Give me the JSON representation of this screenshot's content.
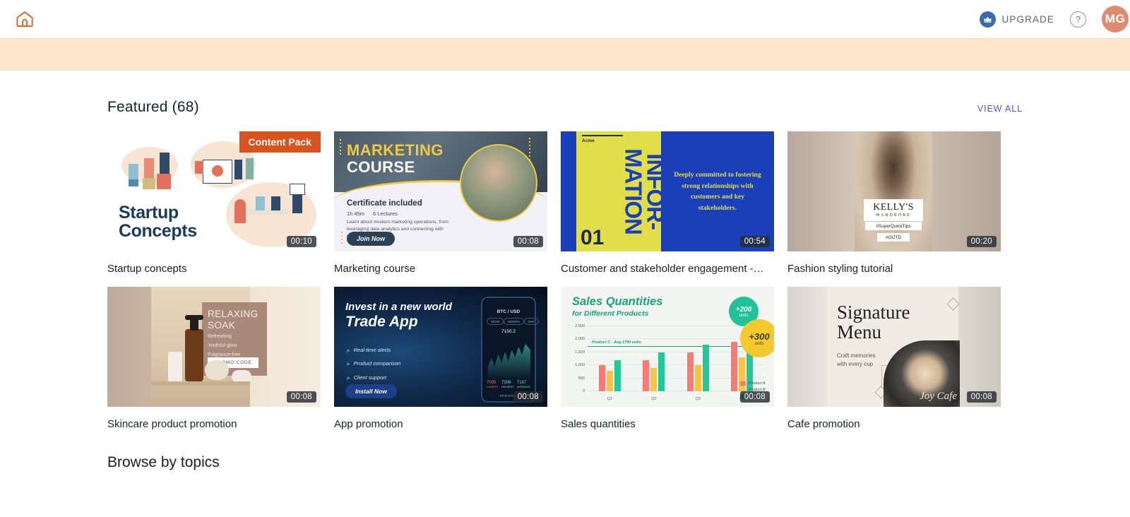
{
  "topbar": {
    "home_icon": "home-icon",
    "upgrade_label": "UPGRADE",
    "crown_icon": "crown-icon",
    "help_label": "?",
    "avatar_initials": "MG"
  },
  "featured": {
    "title": "Featured (68)",
    "view_all": "VIEW ALL",
    "cards": [
      {
        "title": "Startup concepts",
        "duration": "00:10",
        "badge": "Content Pack",
        "art": {
          "headline_line1": "Startup",
          "headline_line2": "Concepts"
        }
      },
      {
        "title": "Marketing course",
        "duration": "00:08",
        "art": {
          "headline_line1": "MARKETING",
          "headline_line2": "COURSE",
          "certificate": "Certificate included",
          "meta_time": "1h 45m",
          "meta_lectures": "6 Lectures",
          "description": "Learn about modern marketing operations, from leveraging data analytics and connecting with customers.",
          "cta": "Join Now"
        }
      },
      {
        "title": "Customer and stakeholder engagement -…",
        "duration": "00:54",
        "art": {
          "brand": "Acme",
          "word_line1": "INFOR-",
          "word_line2": "MATION",
          "number": "01",
          "quote": "Deeply committed to fostering strong relationships with customers and key stakeholders."
        }
      },
      {
        "title": "Fashion styling tutorial",
        "duration": "00:20",
        "art": {
          "brand_line1": "KELLY'S",
          "brand_line2": "WARDROBE",
          "tag1": "#SuperQuickTips",
          "tag2": "#OOTD"
        }
      },
      {
        "title": "Skincare product promotion",
        "duration": "00:08",
        "art": {
          "headline_line1": "RELAXING",
          "headline_line2": "SOAK",
          "bullet1": "Refreshing",
          "bullet2": "Youthful glow",
          "bullet3": "Fragrance-free",
          "cta": "PROMO CODE"
        }
      },
      {
        "title": "App promotion",
        "duration": "00:08",
        "art": {
          "headline_line1": "Invest in a new world",
          "headline_line2": "Trade App",
          "bullet1": "Real-time alerts",
          "bullet2": "Product comparison",
          "bullet3": "Client support",
          "cta": "Install Now",
          "phone_pair": "BTC / USD",
          "phone_price": "7150.2",
          "phone_tab1": "YEAR",
          "phone_tab2": "MONTH",
          "phone_tab3": "DAY",
          "phone_stat1_value": "7005",
          "phone_stat1_label": "LOWEST",
          "phone_stat2_value": "7308",
          "phone_stat2_label": "HIGHEST",
          "phone_stat3_value": "7187",
          "phone_stat3_label": "AVERAGE",
          "phone_footer": "STATISTICS"
        }
      },
      {
        "title": "Sales quantities",
        "duration": "00:08"
      },
      {
        "title": "Cafe promotion",
        "duration": "00:08",
        "art": {
          "headline_line1": "Signature",
          "headline_line2": "Menu",
          "subtitle_line1": "Craft memories",
          "subtitle_line2": "with every cup",
          "script": "Joy Cafe"
        }
      }
    ]
  },
  "browse": {
    "title": "Browse by topics"
  },
  "chart_data": {
    "type": "bar",
    "title": "Sales Quantities",
    "subtitle": "for Different Products",
    "xlabel": "",
    "ylabel": "",
    "categories": [
      "Q1",
      "Q2",
      "Q3",
      "Q4"
    ],
    "ylim": [
      0,
      2500
    ],
    "yticks": [
      0,
      500,
      1000,
      1500,
      2000,
      2500
    ],
    "ytick_labels": [
      "0",
      "500",
      "1,000",
      "1,500",
      "2,000",
      "2,500"
    ],
    "grid": true,
    "legend_position": "bottom-right",
    "series": [
      {
        "name": "Product A",
        "color": "#f97a72",
        "values": [
          1000,
          1200,
          1500,
          1900
        ]
      },
      {
        "name": "Product B",
        "color": "#f9c540",
        "values": [
          800,
          900,
          1000,
          1300
        ]
      },
      {
        "name": "Product C",
        "color": "#21c997",
        "values": [
          1200,
          1500,
          1800,
          2300
        ]
      }
    ],
    "reference_line": {
      "label": "Product C - Avg 1700 units",
      "value": 1700,
      "color": "#18a47c"
    },
    "annotations": [
      {
        "label": "+200",
        "sub": "units",
        "color": "#1fc299"
      },
      {
        "label": "+300",
        "sub": "units",
        "color": "#f5c82e"
      }
    ]
  },
  "colors": {
    "accent_orange": "#d9531e",
    "banner_peach": "#fde5cb",
    "link_blue": "#4a5bc4",
    "avatar": "#dd8c72",
    "crown_blue": "#3a6ab0"
  }
}
